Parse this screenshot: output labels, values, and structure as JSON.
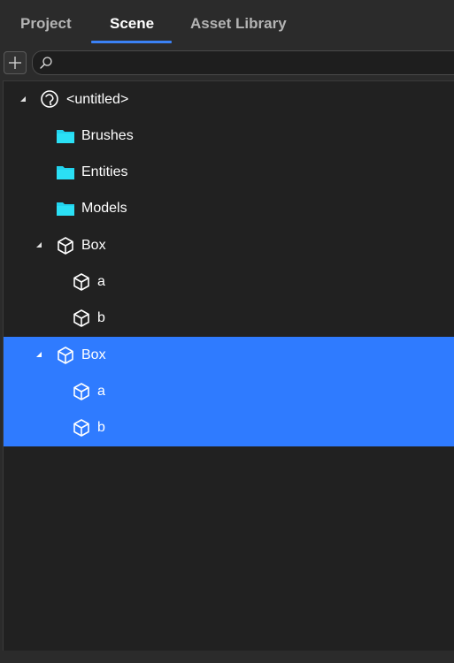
{
  "tabs": [
    {
      "label": "Project",
      "active": false
    },
    {
      "label": "Scene",
      "active": true
    },
    {
      "label": "Asset Library",
      "active": false
    }
  ],
  "toolbar": {
    "add_label": "+",
    "search_value": "",
    "search_placeholder": ""
  },
  "tree": {
    "items": [
      {
        "label": "<untitled>",
        "icon": "scene-icon",
        "expanded": true,
        "selected": false
      },
      {
        "label": "Brushes",
        "icon": "folder-icon",
        "selected": false
      },
      {
        "label": "Entities",
        "icon": "folder-icon",
        "selected": false
      },
      {
        "label": "Models",
        "icon": "folder-icon",
        "selected": false
      },
      {
        "label": "Box",
        "icon": "cube-icon",
        "expanded": true,
        "selected": false
      },
      {
        "label": "a",
        "icon": "cube-icon",
        "selected": false
      },
      {
        "label": "b",
        "icon": "cube-icon",
        "selected": false
      },
      {
        "label": "Box",
        "icon": "cube-icon",
        "expanded": true,
        "selected": true
      },
      {
        "label": "a",
        "icon": "cube-icon",
        "selected": true
      },
      {
        "label": "b",
        "icon": "cube-icon",
        "selected": true
      }
    ]
  },
  "colors": {
    "background": "#2b2b2b",
    "tree_background": "#212121",
    "accent": "#3b82f6",
    "selection": "#2f7bff",
    "folder": "#22d3ee",
    "text": "#ffffff",
    "inactive_tab": "#b4b4b4"
  }
}
